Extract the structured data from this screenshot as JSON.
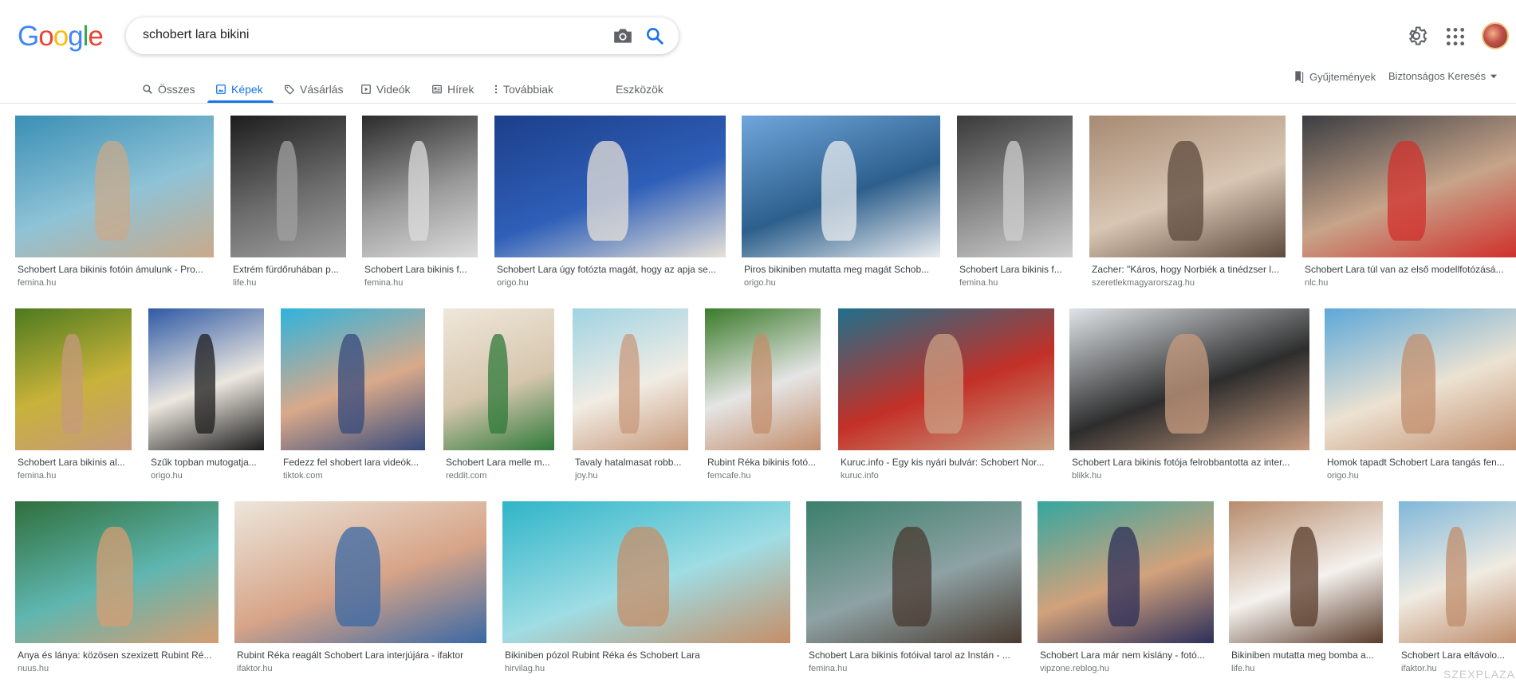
{
  "logo": {
    "letters": [
      "G",
      "o",
      "o",
      "g",
      "l",
      "e"
    ],
    "colors": [
      "#4285F4",
      "#EA4335",
      "#FBBC05",
      "#4285F4",
      "#34A853",
      "#EA4335"
    ]
  },
  "search": {
    "query": "schobert lara bikini"
  },
  "tabs": [
    {
      "label": "Összes",
      "icon": "search-icon"
    },
    {
      "label": "Képek",
      "icon": "image-icon"
    },
    {
      "label": "Vásárlás",
      "icon": "tag-icon"
    },
    {
      "label": "Videók",
      "icon": "play-icon"
    },
    {
      "label": "Hírek",
      "icon": "news-icon"
    },
    {
      "label": "Továbbiak",
      "icon": "more-vert-icon"
    }
  ],
  "tools_label": "Eszközök",
  "header_right": {
    "collections": "Gyűjtemények",
    "safesearch": "Biztonságos Keresés"
  },
  "accent_color": "#1a73e8",
  "results": [
    {
      "caption": "Schobert Lara bikinis fotóin ámulunk - Pro...",
      "source": "femina.hu",
      "colors": [
        "#3a8fb5",
        "#8fc3d6",
        "#caa98a"
      ]
    },
    {
      "caption": "Extrém fürdőruhában p...",
      "source": "life.hu",
      "colors": [
        "#1d1d1d",
        "#6b6b6b",
        "#a0a0a0"
      ]
    },
    {
      "caption": "Schobert Lara bikinis f...",
      "source": "femina.hu",
      "colors": [
        "#2b2b2b",
        "#9a9a9a",
        "#dcdcdc"
      ]
    },
    {
      "caption": "Schobert Lara úgy fotózta magát, hogy az apja se...",
      "source": "origo.hu",
      "colors": [
        "#1c3f8a",
        "#2f5fb8",
        "#e8e2d8"
      ]
    },
    {
      "caption": "Piros bikiniben mutatta meg magát Schob...",
      "source": "origo.hu",
      "colors": [
        "#6fa6dc",
        "#2d5f8c",
        "#e9ecef"
      ]
    },
    {
      "caption": "Schobert Lara bikinis f...",
      "source": "femina.hu",
      "colors": [
        "#3a3a3a",
        "#8c8c8c",
        "#cfcfcf"
      ]
    },
    {
      "caption": "Zacher: \"Káros, hogy Norbiék a tinédzser l...",
      "source": "szeretlekmagyarorszag.hu",
      "colors": [
        "#a78a72",
        "#d8c6b4",
        "#5e4a3c"
      ]
    },
    {
      "caption": "Schobert Lara túl van az első modellfotózásá...",
      "source": "nlc.hu",
      "colors": [
        "#3b3d42",
        "#c7a48a",
        "#d0302c"
      ]
    },
    {
      "caption": "Schobert Lara bikinis al...",
      "source": "femina.hu",
      "colors": [
        "#4d7a1f",
        "#c8b23a",
        "#c69a7e"
      ]
    },
    {
      "caption": "Szűk topban mutogatja...",
      "source": "origo.hu",
      "colors": [
        "#2f5aa6",
        "#ece7df",
        "#1c1c1c"
      ]
    },
    {
      "caption": "Fedezz fel shobert lara videók...",
      "source": "tiktok.com",
      "colors": [
        "#2fb3dd",
        "#d9a98a",
        "#364a7c"
      ]
    },
    {
      "caption": "Schobert Lara melle m...",
      "source": "reddit.com",
      "colors": [
        "#efe7da",
        "#d6c6ae",
        "#2f7a3a"
      ]
    },
    {
      "caption": "Tavaly hatalmasat robb...",
      "source": "joy.hu",
      "colors": [
        "#9fd3e3",
        "#f1ece4",
        "#c89a7c"
      ]
    },
    {
      "caption": "Rubint Réka bikinis fotó...",
      "source": "femcafe.hu",
      "colors": [
        "#3b7b2a",
        "#e5e5e5",
        "#c38d6b"
      ]
    },
    {
      "caption": "Kuruc.info - Egy kis nyári bulvár: Schobert Nor...",
      "source": "kuruc.info",
      "colors": [
        "#1f6f8b",
        "#c33027",
        "#c9a084"
      ]
    },
    {
      "caption": "Schobert Lara bikinis fotója felrobbantotta az inter...",
      "source": "blikk.hu",
      "colors": [
        "#dfe4e8",
        "#2d2d2d",
        "#c79b7f"
      ]
    },
    {
      "caption": "Homok tapadt Schobert Lara tangás fen...",
      "source": "origo.hu",
      "colors": [
        "#5da8d8",
        "#ece2d2",
        "#c28f6e"
      ]
    },
    {
      "caption": "Anya és lánya: közösen szexizett Rubint Ré...",
      "source": "nuus.hu",
      "colors": [
        "#2f6f3c",
        "#5fb6b0",
        "#d79d72"
      ]
    },
    {
      "caption": "Rubint Réka reagált Schobert Lara interjújára - ifaktor",
      "source": "ifaktor.hu",
      "colors": [
        "#ece6dc",
        "#d7a488",
        "#3a68a4"
      ]
    },
    {
      "caption": "Bikiniben pózol Rubint Réka és Schobert Lara",
      "source": "hirvilag.hu",
      "colors": [
        "#2fb5c8",
        "#9fdde4",
        "#c58e68"
      ]
    },
    {
      "caption": "Schobert Lara bikinis fotóival tarol az Instán - ...",
      "source": "femina.hu",
      "colors": [
        "#3b7f6b",
        "#8ea2a4",
        "#4a3a30"
      ]
    },
    {
      "caption": "Schobert Lara már nem kislány - fotó...",
      "source": "vipzone.reblog.hu",
      "colors": [
        "#35a6a0",
        "#d2a27c",
        "#2c2f5a"
      ]
    },
    {
      "caption": "Bikiniben mutatta meg bomba a...",
      "source": "life.hu",
      "colors": [
        "#b88c6c",
        "#f4f1ee",
        "#5a3b2a"
      ]
    },
    {
      "caption": "Schobert Lara eltávolo...",
      "source": "ifaktor.hu",
      "colors": [
        "#7fb7d9",
        "#f0ebe2",
        "#bf8d6c"
      ]
    }
  ],
  "watermark": "SZEXPLAZA"
}
